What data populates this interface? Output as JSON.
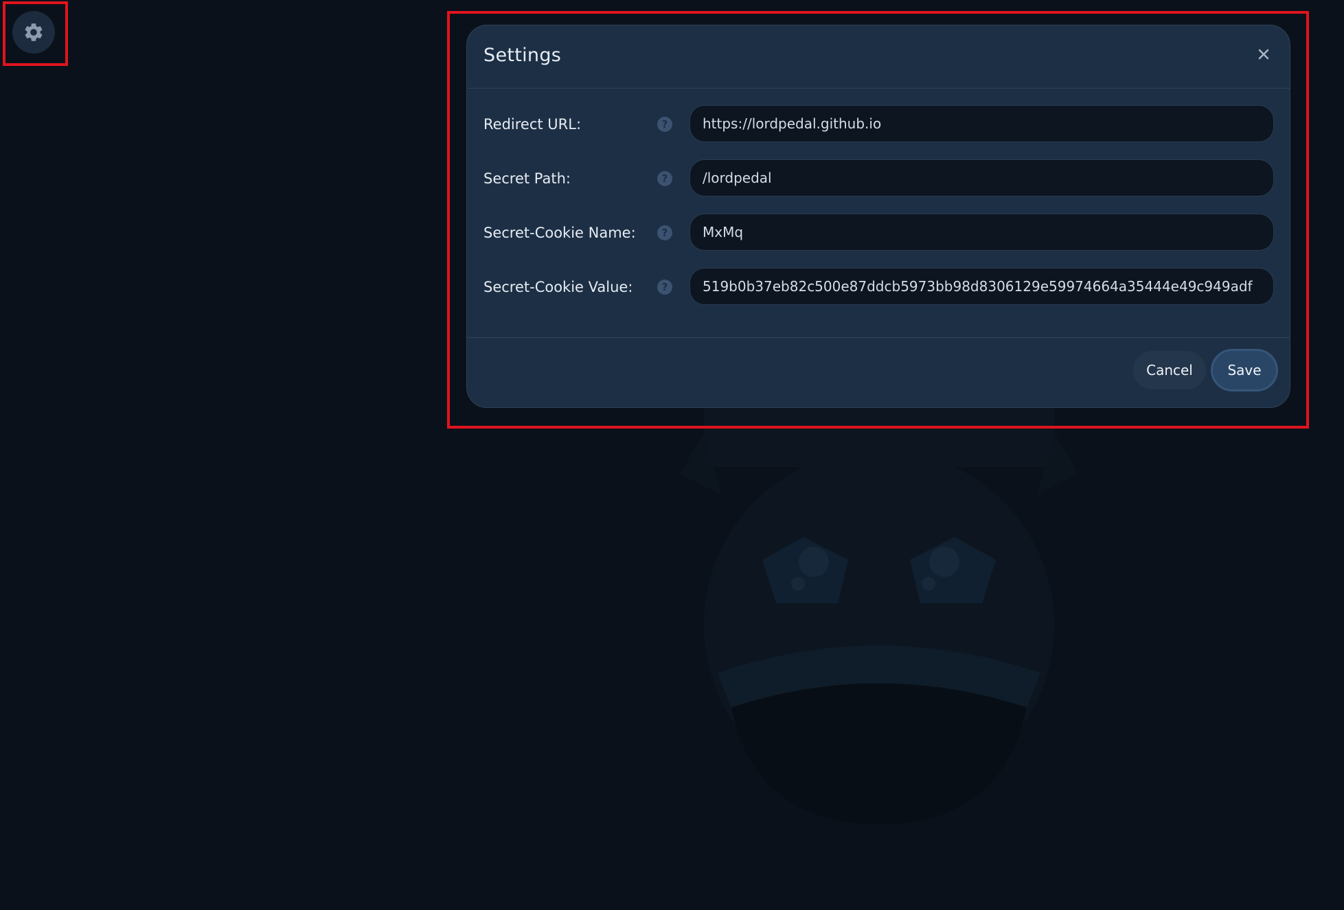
{
  "app": {
    "settings_button_icon": "gear-icon"
  },
  "modal": {
    "title": "Settings",
    "close_icon": "close-icon",
    "fields": [
      {
        "label": "Redirect URL:",
        "help_icon": "question-circle-icon",
        "help_glyph": "?",
        "value": "https://lordpedal.github.io"
      },
      {
        "label": "Secret Path:",
        "help_icon": "question-circle-icon",
        "help_glyph": "?",
        "value": "/lordpedal"
      },
      {
        "label": "Secret-Cookie Name:",
        "help_icon": "question-circle-icon",
        "help_glyph": "?",
        "value": "MxMq"
      },
      {
        "label": "Secret-Cookie Value:",
        "help_icon": "question-circle-icon",
        "help_glyph": "?",
        "value": "519b0b37eb82c500e87ddcb5973bb98d8306129e59974664a35444e49c949adf"
      }
    ],
    "cancel_label": "Cancel",
    "save_label": "Save"
  },
  "colors": {
    "page_background": "#0a111a",
    "modal_background": "#1d2f45",
    "input_background": "#0c1520",
    "highlight_border": "#e0141e",
    "save_button": "#2a4666",
    "cancel_button": "#24364c"
  }
}
